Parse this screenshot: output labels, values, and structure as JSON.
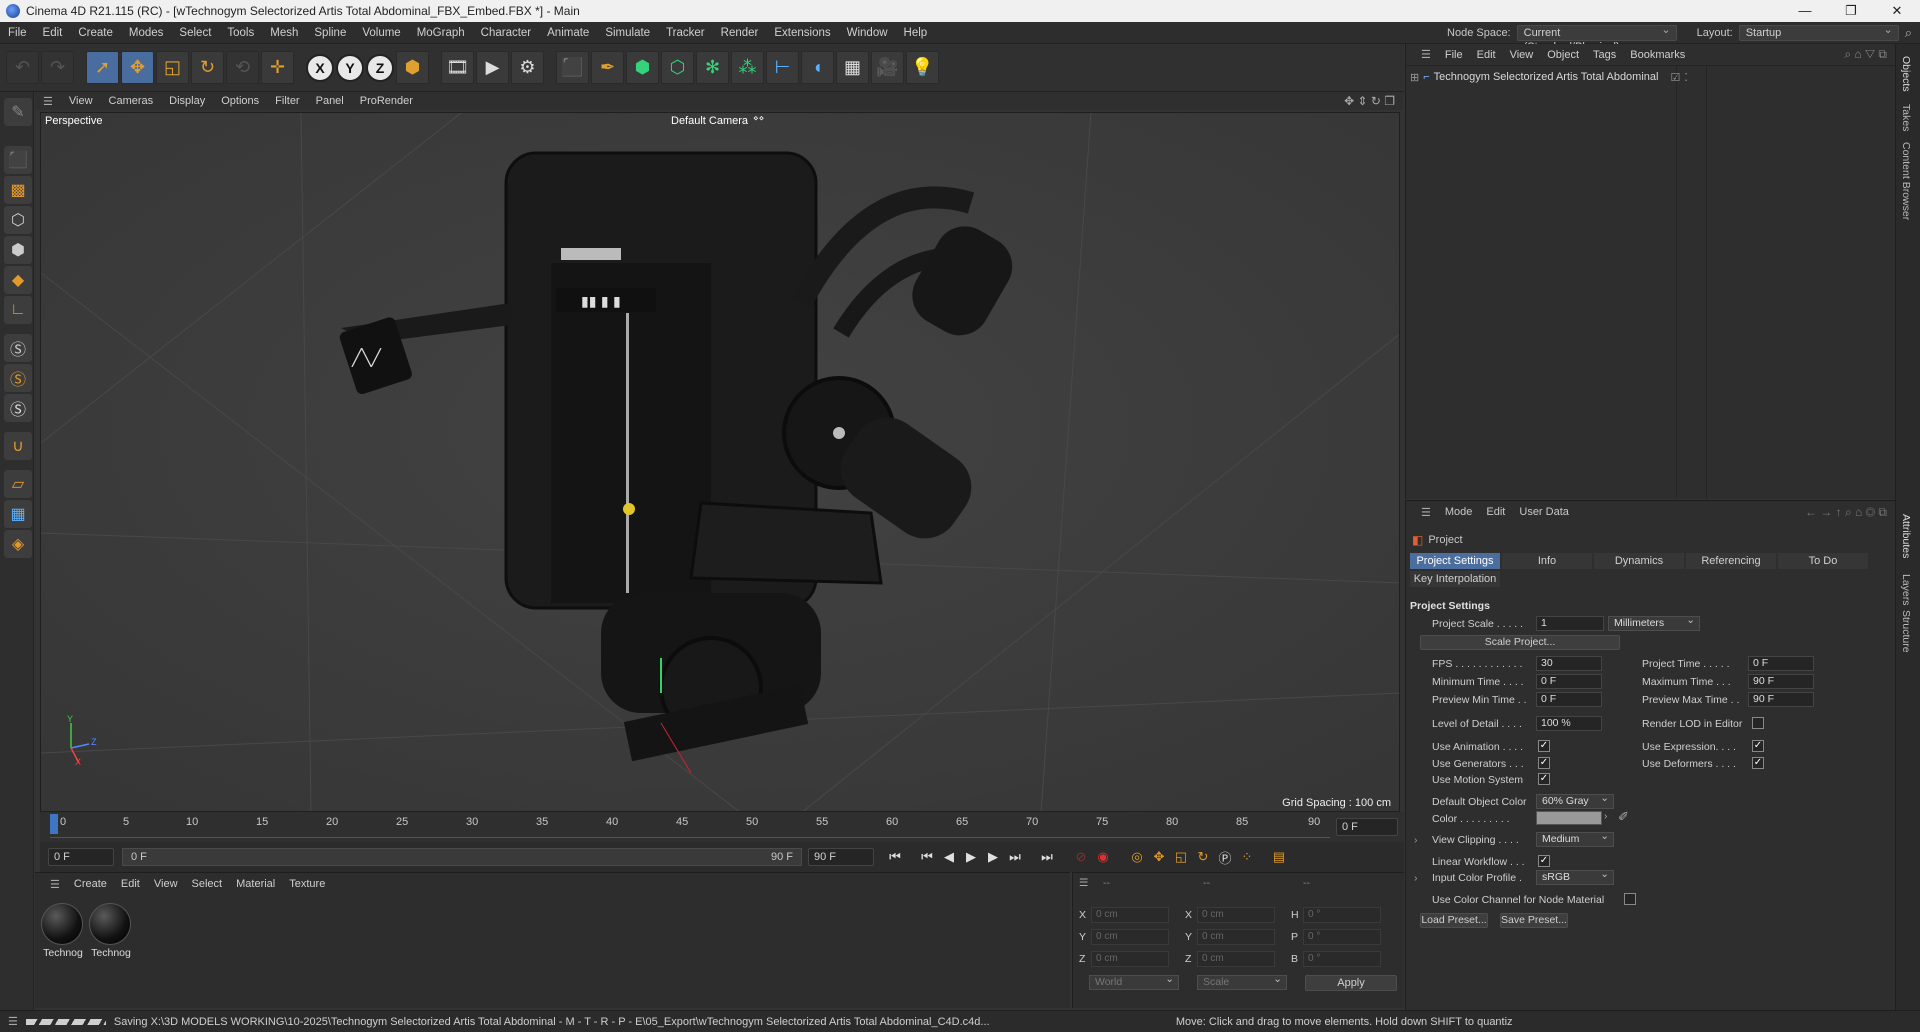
{
  "window": {
    "title": "Cinema 4D R21.115 (RC) - [wTechnogym Selectorized Artis Total Abdominal_FBX_Embed.FBX *] - Main",
    "controls": [
      "—",
      "❐",
      "✕"
    ]
  },
  "menubar": {
    "items": [
      "File",
      "Edit",
      "Create",
      "Modes",
      "Select",
      "Tools",
      "Mesh",
      "Spline",
      "Volume",
      "MoGraph",
      "Character",
      "Animate",
      "Simulate",
      "Tracker",
      "Render",
      "Extensions",
      "Window",
      "Help"
    ],
    "node_space_label": "Node Space:",
    "node_space_value": "Current (Standard/Physical)",
    "layout_label": "Layout:",
    "layout_value": "Startup"
  },
  "toolbar": {
    "icons": [
      "undo-icon",
      "redo-icon",
      "live-select-icon",
      "move-icon",
      "scale-icon",
      "rotate-icon",
      "last-tool-icon",
      "move-axis-icon",
      "x-axis-icon",
      "y-axis-icon",
      "z-axis-icon",
      "coordinate-system-icon",
      "render-region-icon",
      "render-view-icon",
      "render-settings-icon",
      "cube-icon",
      "pen-icon",
      "subdivision-icon",
      "extrude-icon",
      "cloner-icon",
      "array-icon",
      "symmetry-icon",
      "deformer-icon",
      "floor-icon",
      "camera-icon",
      "light-icon"
    ],
    "axis_labels": [
      "X",
      "Y",
      "Z"
    ]
  },
  "viewport": {
    "menu": [
      "View",
      "Cameras",
      "Display",
      "Options",
      "Filter",
      "Panel",
      "ProRender"
    ],
    "view_name": "Perspective",
    "camera": "Default Camera",
    "grid_spacing": "Grid Spacing : 100 cm",
    "axis_x": "X",
    "axis_y": "Y",
    "axis_z": "Z"
  },
  "timeline": {
    "ticks": [
      "0",
      "5",
      "10",
      "15",
      "20",
      "25",
      "30",
      "35",
      "40",
      "45",
      "50",
      "55",
      "60",
      "65",
      "70",
      "75",
      "80",
      "85",
      "90"
    ],
    "current_frame": "0 F",
    "start_field": "0 F",
    "range_start": "0 F",
    "range_end": "90 F",
    "end_field": "90 F"
  },
  "materials": {
    "menu": [
      "Create",
      "Edit",
      "View",
      "Select",
      "Material",
      "Texture"
    ],
    "items": [
      {
        "label": "Technog"
      },
      {
        "label": "Technog"
      }
    ]
  },
  "coordinates": {
    "header": [
      "--",
      "--",
      "--"
    ],
    "rows": [
      {
        "a": "X",
        "av": "0 cm",
        "b": "X",
        "bv": "0 cm",
        "c": "H",
        "cv": "0 °"
      },
      {
        "a": "Y",
        "av": "0 cm",
        "b": "Y",
        "bv": "0 cm",
        "c": "P",
        "cv": "0 °"
      },
      {
        "a": "Z",
        "av": "0 cm",
        "b": "Z",
        "bv": "0 cm",
        "c": "B",
        "cv": "0 °"
      }
    ],
    "mode": "World",
    "scale": "Scale",
    "apply": "Apply"
  },
  "object_manager": {
    "menu": [
      "File",
      "Edit",
      "View",
      "Object",
      "Tags",
      "Bookmarks"
    ],
    "object_name": "Technogym Selectorized Artis Total Abdominal"
  },
  "attributes": {
    "menu": [
      "Mode",
      "Edit",
      "User Data"
    ],
    "title": "Project",
    "tabs": [
      "Project Settings",
      "Info",
      "Dynamics",
      "Referencing",
      "To Do"
    ],
    "tab2": "Key Interpolation",
    "section": "Project Settings",
    "project_scale_label": "Project Scale . . . . .",
    "project_scale": "1",
    "project_scale_unit": "Millimeters",
    "scale_project_btn": "Scale Project...",
    "fps_label": "FPS . . . . . . . . . . . .",
    "fps": "30",
    "project_time_label": "Project Time . . . . .",
    "project_time": "0 F",
    "min_time_label": "Minimum Time . . . .",
    "min_time": "0 F",
    "max_time_label": "Maximum Time . . .",
    "max_time": "90 F",
    "preview_min_label": "Preview Min Time . .",
    "preview_min": "0 F",
    "preview_max_label": "Preview Max Time . .",
    "preview_max": "90 F",
    "lod_label": "Level of Detail . . . .",
    "lod": "100 %",
    "render_lod_label": "Render LOD in Editor",
    "use_animation_label": "Use Animation . . . .",
    "use_expression_label": "Use Expression. . . .",
    "use_generators_label": "Use Generators . . .",
    "use_deformers_label": "Use Deformers . . . .",
    "use_motion_label": "Use Motion System",
    "default_color_label": "Default Object Color",
    "default_color": "60% Gray",
    "color_label": "Color . . . . . . . . .",
    "view_clipping_label": "View Clipping . . . .",
    "view_clipping": "Medium",
    "linear_workflow_label": "Linear Workflow . . .",
    "input_profile_label": "Input Color Profile .",
    "input_profile": "sRGB",
    "use_color_channel_label": "Use Color Channel for Node Material",
    "load_preset": "Load Preset...",
    "save_preset": "Save Preset...",
    "checked_mark": "✓"
  },
  "side_tabs": [
    "Objects",
    "Takes",
    "Content Browser",
    "Attributes",
    "Layers",
    "Structure"
  ],
  "status": {
    "left": "Saving X:\\3D MODELS WORKING\\10-2025\\Technogym Selectorized Artis Total Abdominal - M - T - R - P - E\\05_Export\\wTechnogym Selectorized Artis Total Abdominal_C4D.c4d...",
    "right": "Move: Click and drag to move elements. Hold down SHIFT to quantiz"
  },
  "colors": {
    "accent": "#4b6e9e",
    "viewport_bg": "#3d3d3d",
    "tool_orange": "#e39a2a"
  }
}
